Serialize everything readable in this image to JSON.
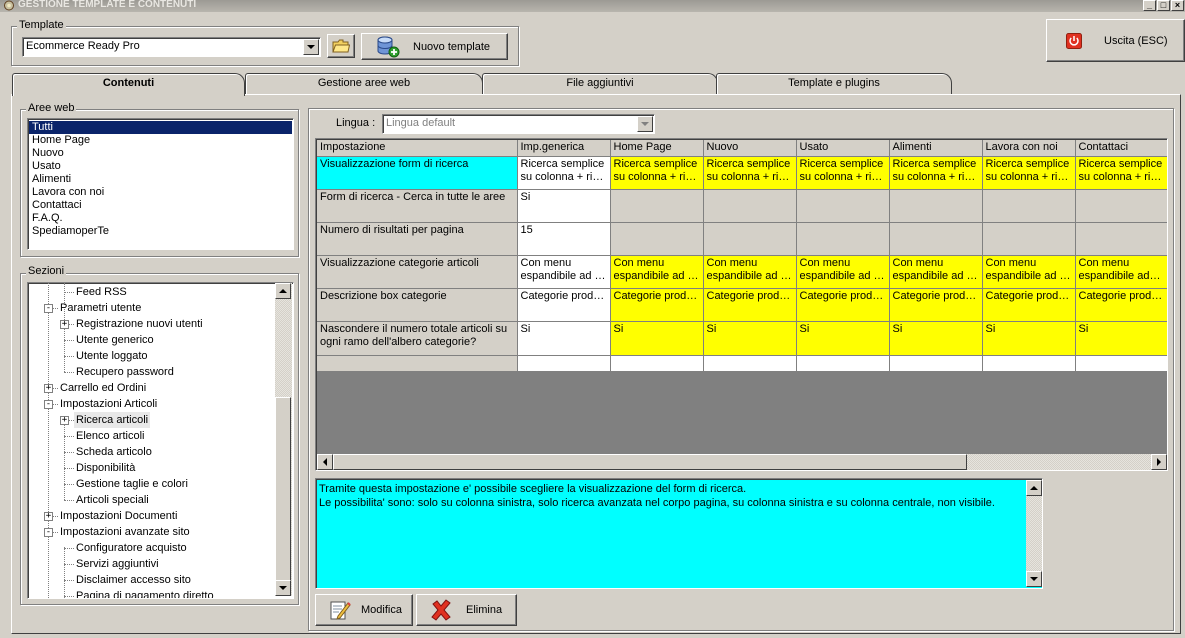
{
  "window": {
    "title": "GESTIONE TEMPLATE E CONTENUTI",
    "minimize_label": "_",
    "maximize_label": "□",
    "close_label": "×"
  },
  "template_group": {
    "legend": "Template",
    "selected": "Ecommerce Ready Pro",
    "new_template_label": "Nuovo template"
  },
  "exit_button": {
    "label": "Uscita (ESC)"
  },
  "tabs": [
    {
      "label": "Contenuti",
      "active": true
    },
    {
      "label": "Gestione aree web",
      "active": false
    },
    {
      "label": "File aggiuntivi",
      "active": false
    },
    {
      "label": "Template e plugins",
      "active": false
    }
  ],
  "aree_web": {
    "legend": "Aree web",
    "items": [
      "Tutti",
      "Home Page",
      "Nuovo",
      "Usato",
      "Alimenti",
      "Lavora con noi",
      "Contattaci",
      "F.A.Q.",
      "SpediamoperTe"
    ],
    "selected_index": 0
  },
  "sezioni": {
    "legend": "Sezioni",
    "tree": [
      {
        "label": "Feed RSS",
        "level": 2,
        "toggle": ""
      },
      {
        "label": "Parametri utente",
        "level": 1,
        "toggle": "-"
      },
      {
        "label": "Registrazione nuovi utenti",
        "level": 2,
        "toggle": "+"
      },
      {
        "label": "Utente generico",
        "level": 2,
        "toggle": ""
      },
      {
        "label": "Utente loggato",
        "level": 2,
        "toggle": ""
      },
      {
        "label": "Recupero password",
        "level": 2,
        "toggle": ""
      },
      {
        "label": "Carrello ed Ordini",
        "level": 1,
        "toggle": "+"
      },
      {
        "label": "Impostazioni Articoli",
        "level": 1,
        "toggle": "-"
      },
      {
        "label": "Ricerca articoli",
        "level": 2,
        "toggle": "+",
        "selected": true
      },
      {
        "label": "Elenco articoli",
        "level": 2,
        "toggle": ""
      },
      {
        "label": "Scheda articolo",
        "level": 2,
        "toggle": ""
      },
      {
        "label": "Disponibilità",
        "level": 2,
        "toggle": ""
      },
      {
        "label": "Gestione taglie e colori",
        "level": 2,
        "toggle": ""
      },
      {
        "label": "Articoli speciali",
        "level": 2,
        "toggle": ""
      },
      {
        "label": "Impostazioni Documenti",
        "level": 1,
        "toggle": "+"
      },
      {
        "label": "Impostazioni avanzate sito",
        "level": 1,
        "toggle": "-"
      },
      {
        "label": "Configuratore acquisto",
        "level": 2,
        "toggle": ""
      },
      {
        "label": "Servizi aggiuntivi",
        "level": 2,
        "toggle": ""
      },
      {
        "label": "Disclaimer accesso sito",
        "level": 2,
        "toggle": ""
      },
      {
        "label": "Pagina di pagamento diretto",
        "level": 2,
        "toggle": ""
      }
    ]
  },
  "lingua": {
    "label": "Lingua :",
    "selected": "Lingua default"
  },
  "grid": {
    "columns": [
      "Impostazione",
      "Imp.generica",
      "Home Page",
      "Nuovo",
      "Usato",
      "Alimenti",
      "Lavora con noi",
      "Contattaci"
    ],
    "rows": [
      {
        "label": "Visualizzazione form di ricerca",
        "highlight": true,
        "cells": [
          [
            "Ricerca semplice",
            "su colonna + ric..."
          ],
          [
            "Ricerca semplice",
            "su colonna + ric..."
          ],
          [
            "Ricerca semplice",
            "su colonna + ric..."
          ],
          [
            "Ricerca semplice",
            "su colonna + ric..."
          ],
          [
            "Ricerca semplice",
            "su colonna + ric..."
          ],
          [
            "Ricerca semplice",
            "su colonna + ric..."
          ],
          [
            "Ricerca semplice",
            "su colonna + ric..."
          ]
        ],
        "fill": [
          "gen",
          "ylw",
          "ylw",
          "ylw",
          "ylw",
          "ylw",
          "ylw"
        ]
      },
      {
        "label": "Form di ricerca - Cerca in tutte le aree",
        "highlight": false,
        "cells": [
          [
            "Si"
          ],
          [
            ""
          ],
          [
            ""
          ],
          [
            ""
          ],
          [
            ""
          ],
          [
            ""
          ],
          [
            ""
          ]
        ],
        "fill": [
          "gen",
          "empty",
          "empty",
          "empty",
          "empty",
          "empty",
          "empty"
        ]
      },
      {
        "label": "Numero di risultati per pagina",
        "highlight": false,
        "cells": [
          [
            "15"
          ],
          [
            ""
          ],
          [
            ""
          ],
          [
            ""
          ],
          [
            ""
          ],
          [
            ""
          ],
          [
            ""
          ]
        ],
        "fill": [
          "gen",
          "empty",
          "empty",
          "empty",
          "empty",
          "empty",
          "empty"
        ]
      },
      {
        "label": "Visualizzazione categorie articoli",
        "highlight": false,
        "cells": [
          [
            "Con menu",
            "espandibile ad a..."
          ],
          [
            "Con menu",
            "espandibile ad a..."
          ],
          [
            "Con menu",
            "espandibile ad a..."
          ],
          [
            "Con menu",
            "espandibile ad a..."
          ],
          [
            "Con menu",
            "espandibile ad a..."
          ],
          [
            "Con menu",
            "espandibile ad a..."
          ],
          [
            "Con menu",
            "espandibile ad a..."
          ]
        ],
        "fill": [
          "gen",
          "ylw",
          "ylw",
          "ylw",
          "ylw",
          "ylw",
          "ylw"
        ]
      },
      {
        "label": "Descrizione box categorie",
        "highlight": false,
        "cells": [
          [
            "Categorie prodotto"
          ],
          [
            "Categorie prodotto"
          ],
          [
            "Categorie prodotto"
          ],
          [
            "Categorie prodotto"
          ],
          [
            "Categorie prodotto"
          ],
          [
            "Categorie prodotto"
          ],
          [
            "Categorie prodotto"
          ]
        ],
        "fill": [
          "gen",
          "ylw",
          "ylw",
          "ylw",
          "ylw",
          "ylw",
          "ylw"
        ]
      },
      {
        "label": "Nascondere il numero totale articoli su ogni ramo dell'albero categorie?",
        "highlight": false,
        "cells": [
          [
            "Si"
          ],
          [
            "Si"
          ],
          [
            "Si"
          ],
          [
            "Si"
          ],
          [
            "Si"
          ],
          [
            "Si"
          ],
          [
            "Si"
          ]
        ],
        "fill": [
          "gen",
          "ylw",
          "ylw",
          "ylw",
          "ylw",
          "ylw",
          "ylw"
        ]
      }
    ]
  },
  "description": {
    "line1": "Tramite questa impostazione e' possibile scegliere la visualizzazione del form di ricerca.",
    "line2": "Le possibilita' sono: solo su colonna sinistra, solo ricerca avanzata nel corpo pagina, su colonna sinistra e su colonna centrale, non visibile."
  },
  "actions": {
    "modifica_label": "Modifica",
    "elimina_label": "Elimina"
  },
  "colors": {
    "highlight_cyan": "#00ffff",
    "override_yellow": "#ffff00",
    "selection_blue": "#0a246a",
    "window_gray": "#d4d0c8"
  }
}
